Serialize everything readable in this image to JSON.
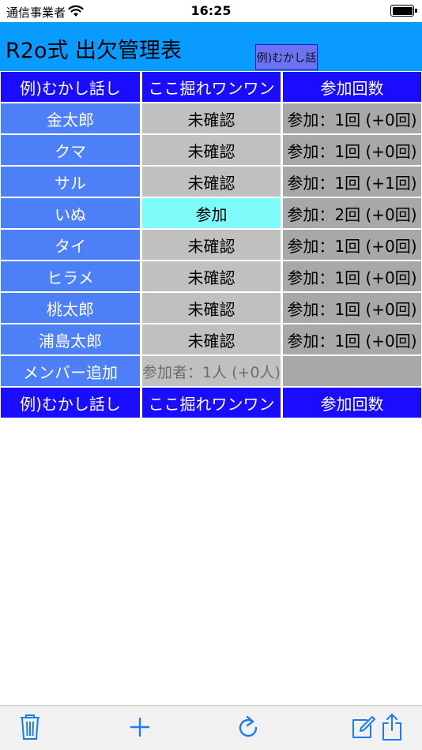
{
  "status_bar": {
    "carrier": "通信事業者",
    "time": "16:25"
  },
  "header": {
    "title": "R2o式 出欠管理表",
    "event_button": "例)むかし話"
  },
  "table": {
    "header_row": {
      "name": "例)むかし話し",
      "event": "ここ掘れワンワン",
      "count": "参加回数"
    },
    "rows": [
      {
        "name": "金太郎",
        "status": "未確認",
        "count": "参加：1回 (+0回)",
        "attending": false
      },
      {
        "name": "クマ",
        "status": "未確認",
        "count": "参加：1回 (+0回)",
        "attending": false
      },
      {
        "name": "サル",
        "status": "未確認",
        "count": "参加：1回 (+1回)",
        "attending": false
      },
      {
        "name": "いぬ",
        "status": "参加",
        "count": "参加：2回 (+0回)",
        "attending": true
      },
      {
        "name": "タイ",
        "status": "未確認",
        "count": "参加：1回 (+0回)",
        "attending": false
      },
      {
        "name": "ヒラメ",
        "status": "未確認",
        "count": "参加：1回 (+0回)",
        "attending": false
      },
      {
        "name": "桃太郎",
        "status": "未確認",
        "count": "参加：1回 (+0回)",
        "attending": false
      },
      {
        "name": "浦島太郎",
        "status": "未確認",
        "count": "参加：1回 (+0回)",
        "attending": false
      }
    ],
    "add_member": "メンバー追加",
    "participants_total": "参加者：1人 (+0人)",
    "footer_row": {
      "name": "例)むかし話し",
      "event": "ここ掘れワンワン",
      "count": "参加回数"
    }
  },
  "toolbar": {
    "icons": [
      "trash-icon",
      "plus-icon",
      "refresh-icon",
      "edit-icon",
      "share-icon"
    ]
  },
  "colors": {
    "header_bg": "#0a9bff",
    "column_header_bg": "#1a0dff",
    "name_bg": "#4d7ff7",
    "status_bg": "#c0c0c0",
    "attend_bg": "#7dfbfb",
    "count_bg": "#a8a8a8",
    "toolbar_icon": "#1a7cf5"
  }
}
